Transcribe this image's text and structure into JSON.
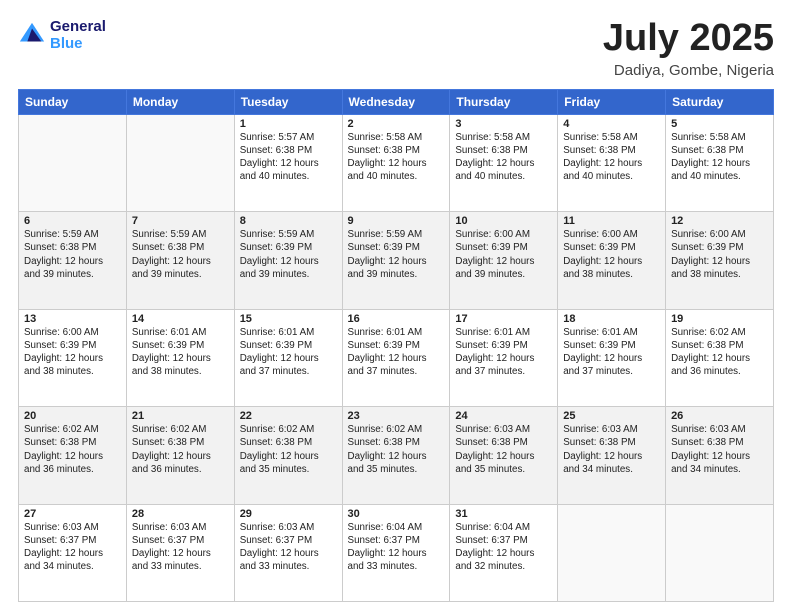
{
  "header": {
    "logo_line1": "General",
    "logo_line2": "Blue",
    "month": "July 2025",
    "location": "Dadiya, Gombe, Nigeria"
  },
  "weekdays": [
    "Sunday",
    "Monday",
    "Tuesday",
    "Wednesday",
    "Thursday",
    "Friday",
    "Saturday"
  ],
  "weeks": [
    [
      {
        "day": "",
        "info": ""
      },
      {
        "day": "",
        "info": ""
      },
      {
        "day": "1",
        "info": "Sunrise: 5:57 AM\nSunset: 6:38 PM\nDaylight: 12 hours\nand 40 minutes."
      },
      {
        "day": "2",
        "info": "Sunrise: 5:58 AM\nSunset: 6:38 PM\nDaylight: 12 hours\nand 40 minutes."
      },
      {
        "day": "3",
        "info": "Sunrise: 5:58 AM\nSunset: 6:38 PM\nDaylight: 12 hours\nand 40 minutes."
      },
      {
        "day": "4",
        "info": "Sunrise: 5:58 AM\nSunset: 6:38 PM\nDaylight: 12 hours\nand 40 minutes."
      },
      {
        "day": "5",
        "info": "Sunrise: 5:58 AM\nSunset: 6:38 PM\nDaylight: 12 hours\nand 40 minutes."
      }
    ],
    [
      {
        "day": "6",
        "info": "Sunrise: 5:59 AM\nSunset: 6:38 PM\nDaylight: 12 hours\nand 39 minutes."
      },
      {
        "day": "7",
        "info": "Sunrise: 5:59 AM\nSunset: 6:38 PM\nDaylight: 12 hours\nand 39 minutes."
      },
      {
        "day": "8",
        "info": "Sunrise: 5:59 AM\nSunset: 6:39 PM\nDaylight: 12 hours\nand 39 minutes."
      },
      {
        "day": "9",
        "info": "Sunrise: 5:59 AM\nSunset: 6:39 PM\nDaylight: 12 hours\nand 39 minutes."
      },
      {
        "day": "10",
        "info": "Sunrise: 6:00 AM\nSunset: 6:39 PM\nDaylight: 12 hours\nand 39 minutes."
      },
      {
        "day": "11",
        "info": "Sunrise: 6:00 AM\nSunset: 6:39 PM\nDaylight: 12 hours\nand 38 minutes."
      },
      {
        "day": "12",
        "info": "Sunrise: 6:00 AM\nSunset: 6:39 PM\nDaylight: 12 hours\nand 38 minutes."
      }
    ],
    [
      {
        "day": "13",
        "info": "Sunrise: 6:00 AM\nSunset: 6:39 PM\nDaylight: 12 hours\nand 38 minutes."
      },
      {
        "day": "14",
        "info": "Sunrise: 6:01 AM\nSunset: 6:39 PM\nDaylight: 12 hours\nand 38 minutes."
      },
      {
        "day": "15",
        "info": "Sunrise: 6:01 AM\nSunset: 6:39 PM\nDaylight: 12 hours\nand 37 minutes."
      },
      {
        "day": "16",
        "info": "Sunrise: 6:01 AM\nSunset: 6:39 PM\nDaylight: 12 hours\nand 37 minutes."
      },
      {
        "day": "17",
        "info": "Sunrise: 6:01 AM\nSunset: 6:39 PM\nDaylight: 12 hours\nand 37 minutes."
      },
      {
        "day": "18",
        "info": "Sunrise: 6:01 AM\nSunset: 6:39 PM\nDaylight: 12 hours\nand 37 minutes."
      },
      {
        "day": "19",
        "info": "Sunrise: 6:02 AM\nSunset: 6:38 PM\nDaylight: 12 hours\nand 36 minutes."
      }
    ],
    [
      {
        "day": "20",
        "info": "Sunrise: 6:02 AM\nSunset: 6:38 PM\nDaylight: 12 hours\nand 36 minutes."
      },
      {
        "day": "21",
        "info": "Sunrise: 6:02 AM\nSunset: 6:38 PM\nDaylight: 12 hours\nand 36 minutes."
      },
      {
        "day": "22",
        "info": "Sunrise: 6:02 AM\nSunset: 6:38 PM\nDaylight: 12 hours\nand 35 minutes."
      },
      {
        "day": "23",
        "info": "Sunrise: 6:02 AM\nSunset: 6:38 PM\nDaylight: 12 hours\nand 35 minutes."
      },
      {
        "day": "24",
        "info": "Sunrise: 6:03 AM\nSunset: 6:38 PM\nDaylight: 12 hours\nand 35 minutes."
      },
      {
        "day": "25",
        "info": "Sunrise: 6:03 AM\nSunset: 6:38 PM\nDaylight: 12 hours\nand 34 minutes."
      },
      {
        "day": "26",
        "info": "Sunrise: 6:03 AM\nSunset: 6:38 PM\nDaylight: 12 hours\nand 34 minutes."
      }
    ],
    [
      {
        "day": "27",
        "info": "Sunrise: 6:03 AM\nSunset: 6:37 PM\nDaylight: 12 hours\nand 34 minutes."
      },
      {
        "day": "28",
        "info": "Sunrise: 6:03 AM\nSunset: 6:37 PM\nDaylight: 12 hours\nand 33 minutes."
      },
      {
        "day": "29",
        "info": "Sunrise: 6:03 AM\nSunset: 6:37 PM\nDaylight: 12 hours\nand 33 minutes."
      },
      {
        "day": "30",
        "info": "Sunrise: 6:04 AM\nSunset: 6:37 PM\nDaylight: 12 hours\nand 33 minutes."
      },
      {
        "day": "31",
        "info": "Sunrise: 6:04 AM\nSunset: 6:37 PM\nDaylight: 12 hours\nand 32 minutes."
      },
      {
        "day": "",
        "info": ""
      },
      {
        "day": "",
        "info": ""
      }
    ]
  ]
}
